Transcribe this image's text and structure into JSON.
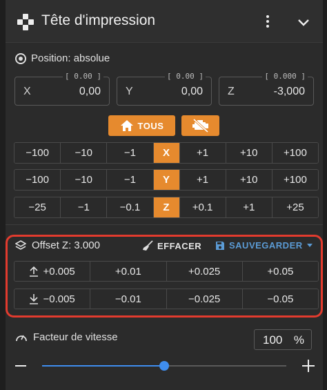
{
  "header": {
    "title": "Tête d'impression",
    "icon": "gamepad-icon"
  },
  "position": {
    "label": "Position: absolue",
    "fields": [
      {
        "axis": "X",
        "value": "0,00",
        "hint": "[ 0.00 ]"
      },
      {
        "axis": "Y",
        "value": "0,00",
        "hint": "[ 0.00 ]"
      },
      {
        "axis": "Z",
        "value": "-3,000",
        "hint": "[ 0.000 ]"
      }
    ]
  },
  "buttons": {
    "home_all": "TOUS"
  },
  "jog": {
    "x": [
      "−100",
      "−10",
      "−1",
      "X",
      "+1",
      "+10",
      "+100"
    ],
    "y": [
      "−100",
      "−10",
      "−1",
      "Y",
      "+1",
      "+10",
      "+100"
    ],
    "z": [
      "−25",
      "−1",
      "−0.1",
      "Z",
      "+0.1",
      "+1",
      "+25"
    ]
  },
  "offset": {
    "label": "Offset Z: 3.000",
    "clear": "EFFACER",
    "save": "SAUVEGARDER",
    "up": [
      "+0.005",
      "+0.01",
      "+0.025",
      "+0.05"
    ],
    "down": [
      "−0.005",
      "−0.01",
      "−0.025",
      "−0.05"
    ]
  },
  "speed": {
    "label": "Facteur de vitesse",
    "value": "100",
    "unit": "%",
    "slider_fraction": 0.5
  },
  "colors": {
    "accent_orange": "#e68a2e",
    "accent_blue": "#3f8ef0",
    "highlight_red": "#e23b2e"
  }
}
